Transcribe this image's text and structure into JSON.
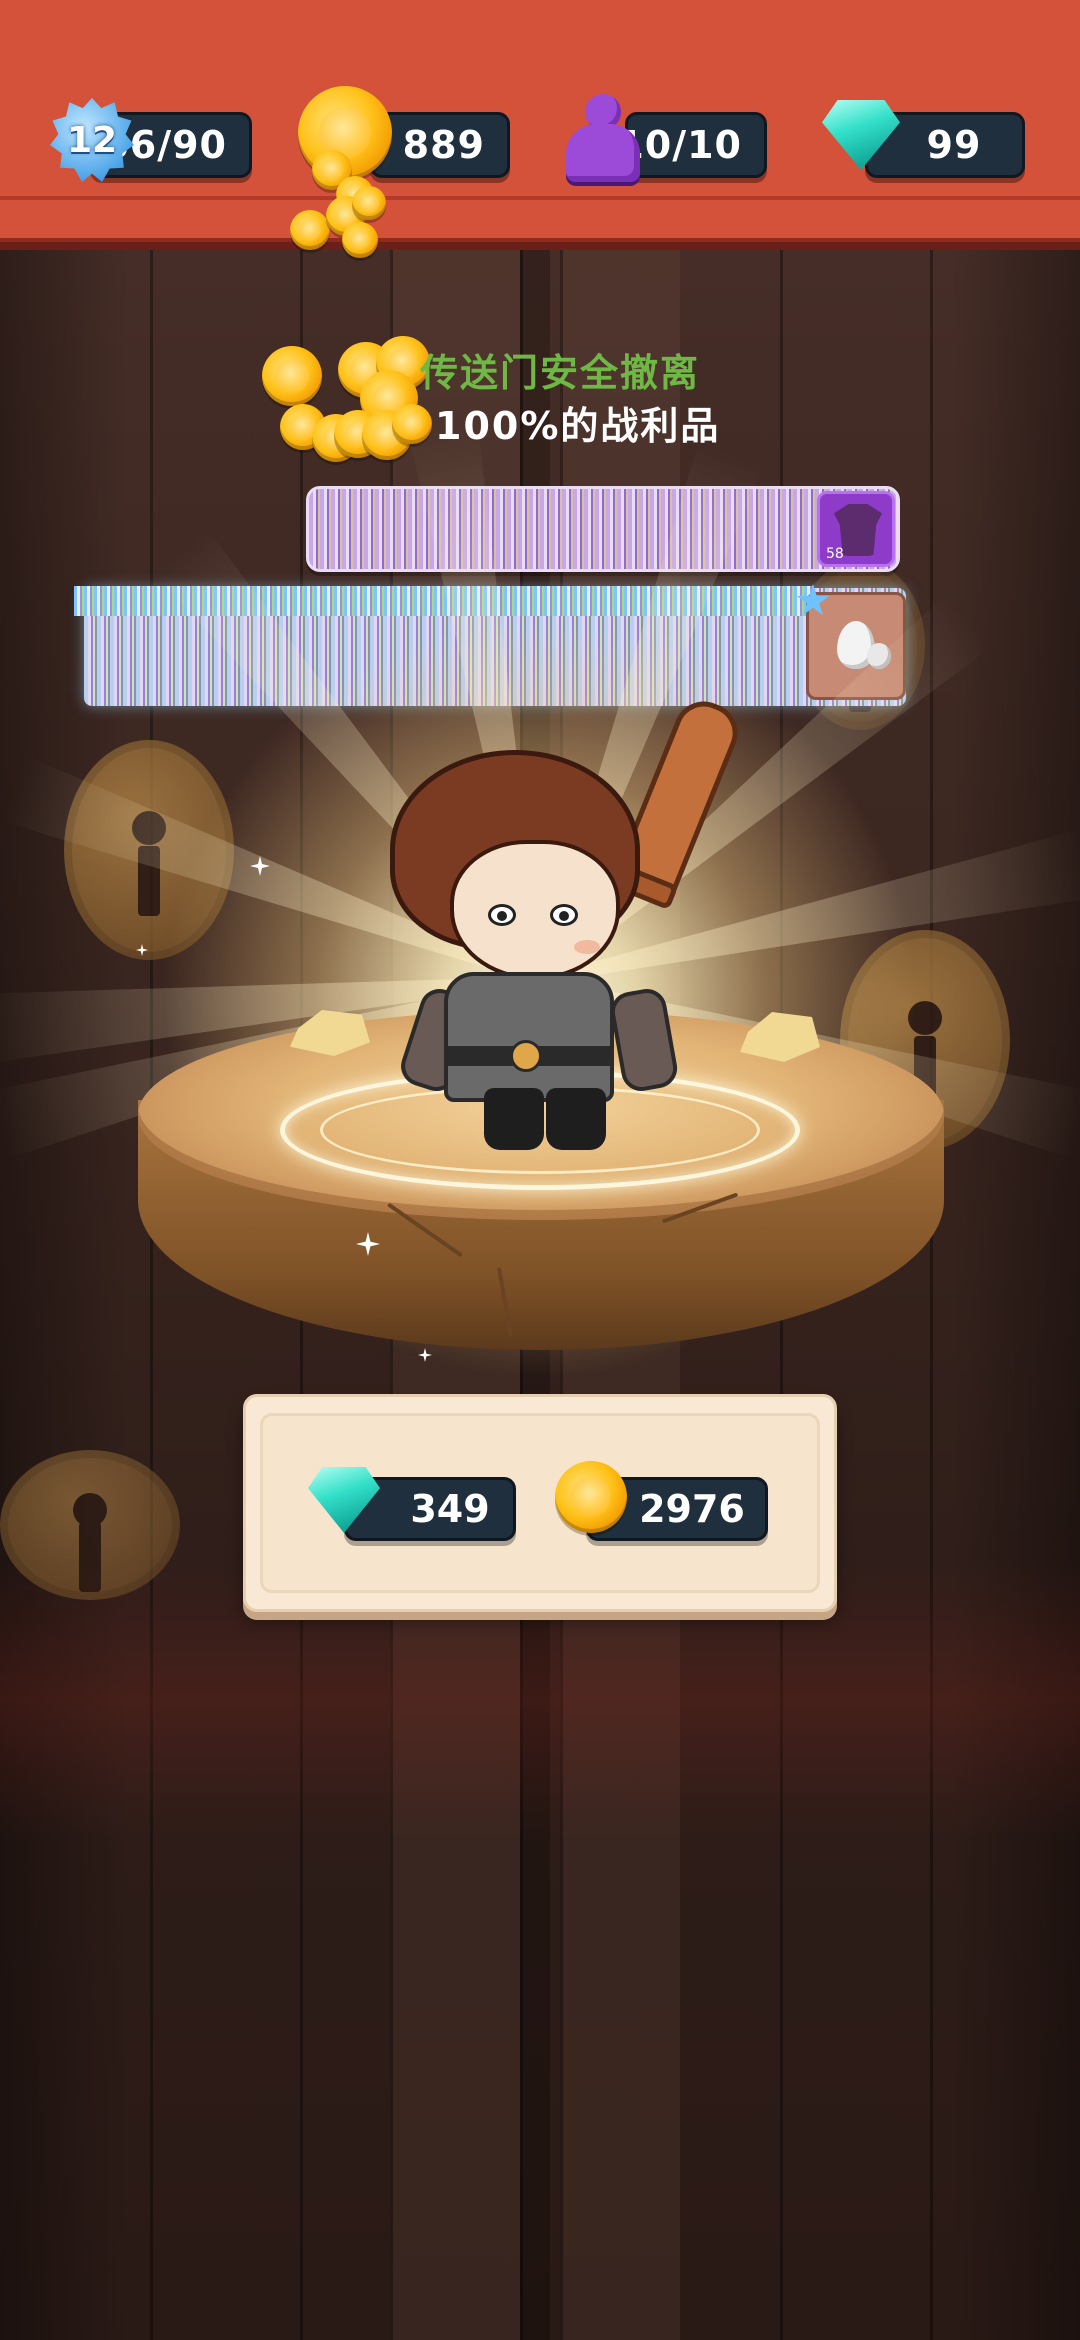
{
  "header": {
    "level": "12",
    "xp": "66/90",
    "coins": "889",
    "energy": "10/10",
    "gems": "99"
  },
  "message": {
    "line1": "传送门安全撤离",
    "line2": "100%的战利品"
  },
  "loot": {
    "armor_count": "58"
  },
  "rewards": {
    "gems": "349",
    "coins": "2976"
  },
  "colors": {
    "header_bg": "#d4513a",
    "stat_bg": "#1f2f3d",
    "message_green": "#6fb845",
    "panel_bg": "#f8e8d4"
  },
  "icons": {
    "level": "level-star-badge-icon",
    "coins": "gold-coin-icon",
    "energy": "purple-pawn-icon",
    "gems": "teal-gem-icon",
    "armor": "purple-armor-icon",
    "egg": "egg-icon"
  }
}
